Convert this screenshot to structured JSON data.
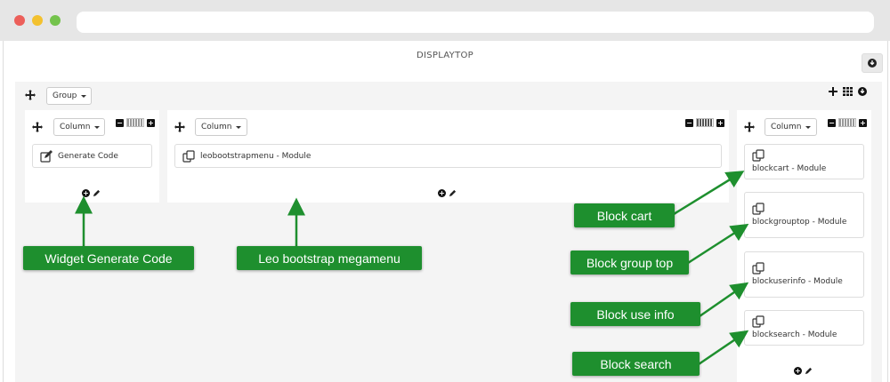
{
  "page": {
    "title": "DISPLAYTOP"
  },
  "group": {
    "label": "Group"
  },
  "columns": [
    {
      "label": "Column",
      "widgets": [
        "Generate Code"
      ]
    },
    {
      "label": "Column",
      "widgets": [
        "leobootstrapmenu - Module"
      ]
    },
    {
      "label": "Column",
      "widgets": [
        "blockcart - Module",
        "blockgrouptop - Module",
        "blockuserinfo - Module",
        "blocksearch - Module"
      ]
    }
  ],
  "callouts": {
    "widget_generate_code": "Widget Generate Code",
    "leo_bootstrap": "Leo bootstrap megamenu",
    "block_cart": "Block cart",
    "block_group_top": "Block group top",
    "block_use_info": "Block use info",
    "block_search": "Block search"
  },
  "colors": {
    "callout": "#1e8f2e",
    "arrow": "#1e8f2e",
    "group_bg": "#f4f4f4"
  },
  "icons": [
    "move-icon",
    "plus-icon",
    "grid-icon",
    "download-icon",
    "minus-icon",
    "edit-icon",
    "copy-icon",
    "pencil-icon"
  ]
}
